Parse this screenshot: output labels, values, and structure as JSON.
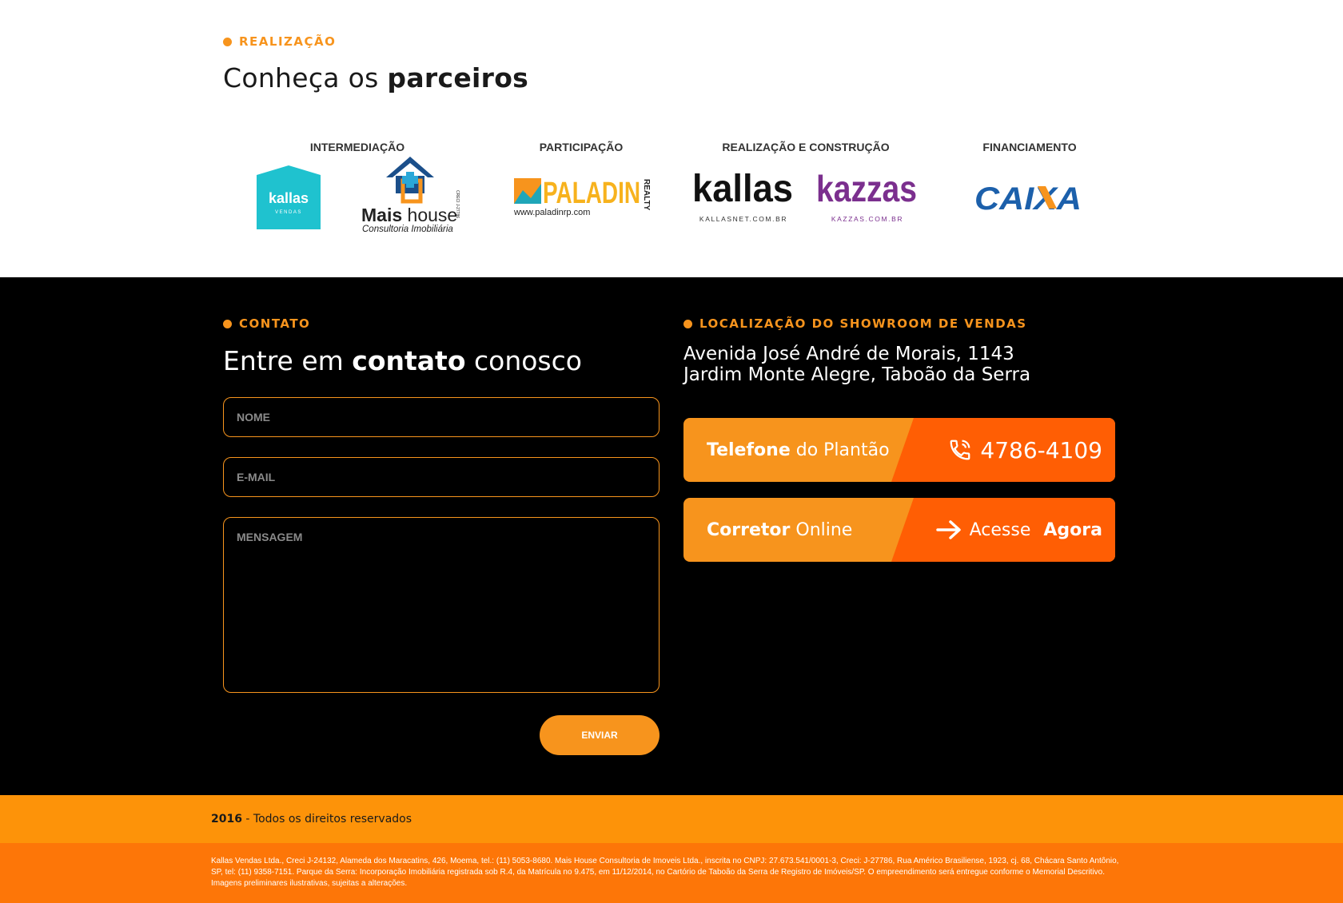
{
  "partners": {
    "eyebrow": "REALIZAÇÃO",
    "heading_light": "Conheça os ",
    "heading_bold": "parceiros",
    "categories": [
      "INTERMEDIAÇÃO",
      "PARTICIPAÇÃO",
      "REALIZAÇÃO E CONSTRUÇÃO",
      "FINANCIAMENTO"
    ],
    "logos": {
      "kallas_vendas": {
        "name": "kallas",
        "sub": "VENDAS"
      },
      "mais_house": {
        "name_bold": "Mais",
        "name_light": " house",
        "sub": "Consultoria Imobiliária",
        "creci": "CRECI J-27786"
      },
      "paladin": {
        "name": "PALADIN",
        "realty": "REALTY",
        "url": "www.paladinrp.com"
      },
      "kallas": {
        "name": "kallas",
        "url": "KALLASNET.COM.BR"
      },
      "kazzas": {
        "name": "kazzas",
        "url": "KAZZAS.COM.BR"
      },
      "caixa": {
        "name": "CAIXA"
      }
    }
  },
  "contact": {
    "eyebrow": "CONTATO",
    "heading_1": "Entre em ",
    "heading_bold": "contato",
    "heading_2": " conosco",
    "fields": {
      "name_placeholder": "NOME",
      "email_placeholder": "E-MAIL",
      "message_placeholder": "MENSAGEM"
    },
    "send_label": "ENVIAR"
  },
  "location": {
    "eyebrow": "LOCALIZAÇÃO DO SHOWROOM DE VENDAS",
    "address_line1": "Avenida José André de Morais, 1143",
    "address_line2": "Jardim Monte Alegre, Taboão da Serra",
    "phone_cta": {
      "label_bold": "Telefone",
      "label_light": "do Plantão",
      "value": "4786-4109"
    },
    "broker_cta": {
      "label_bold": "Corretor",
      "label_light": "Online",
      "action_light": "Acesse",
      "action_bold": "Agora"
    }
  },
  "footer": {
    "year": "2016",
    "rights": " - Todos os direitos reservados",
    "legal": "Kallas Vendas Ltda., Creci J-24132, Alameda dos Maracatins, 426, Moema, tel.: (11) 5053-8680. Mais House Consultoria de Imoveis Ltda., inscrita no CNPJ: 27.673.541/0001-3, Creci: J-27786, Rua Américo Brasiliense, 1923, cj. 68, Chácara Santo Antônio, SP, tel: (11) 9358-7151. Parque da Serra: Incorporação Imobiliária registrada sob R.4, da Matrícula no 9.475, em 11/12/2014, no Cartório de Taboão da Serra de Registro de Imóveis/SP. O empreendimento será entregue conforme o Memorial Descritivo. Imagens preliminares ilustrativas, sujeitas a alterações."
  },
  "colors": {
    "accent": "#f7941d",
    "accent_dark": "#ff5e04",
    "footer_top": "#fd9309",
    "footer_bottom": "#fd7608",
    "caixa_blue": "#1c60ab",
    "kazzas_purple": "#7b2f8e",
    "kallas_teal": "#1fc2cf"
  }
}
